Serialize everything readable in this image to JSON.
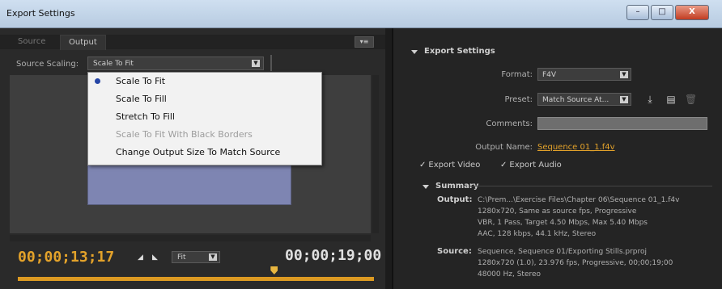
{
  "window": {
    "title": "Export Settings",
    "controls": {
      "minimize": "–",
      "maximize": "□",
      "close": "X"
    }
  },
  "left": {
    "tabs": [
      {
        "label": "Source"
      },
      {
        "label": "Output"
      }
    ],
    "panel_menu": "▾≡",
    "source_scaling": {
      "label": "Source Scaling:",
      "value": "Scale To Fit",
      "options": [
        {
          "label": "Scale To Fit",
          "selected": true,
          "enabled": true
        },
        {
          "label": "Scale To Fill",
          "selected": false,
          "enabled": true
        },
        {
          "label": "Stretch To Fill",
          "selected": false,
          "enabled": true
        },
        {
          "label": "Scale To Fit With Black Borders",
          "selected": false,
          "enabled": false
        },
        {
          "label": "Change Output Size To Match Source",
          "selected": false,
          "enabled": true
        }
      ]
    },
    "timecode_current": "00;00;13;17",
    "timecode_duration": "00;00;19;00",
    "zoom": "Fit",
    "playhead_fraction": 0.72
  },
  "right": {
    "export_settings": {
      "heading": "Export Settings",
      "format": {
        "label": "Format:",
        "value": "F4V"
      },
      "preset": {
        "label": "Preset:",
        "value": "Match Source At..."
      },
      "comments": {
        "label": "Comments:",
        "value": ""
      },
      "output_name": {
        "label": "Output Name:",
        "value": "Sequence 01_1.f4v"
      },
      "export_video": {
        "label": "Export Video",
        "checked": true
      },
      "export_audio": {
        "label": "Export Audio",
        "checked": true
      }
    },
    "summary": {
      "heading": "Summary",
      "output_label": "Output:",
      "output_lines": [
        "C:\\Prem...\\Exercise Files\\Chapter 06\\Sequence 01_1.f4v",
        "1280x720, Same as source fps, Progressive",
        "VBR, 1 Pass, Target 4.50 Mbps, Max 5.40 Mbps",
        "AAC, 128 kbps, 44.1 kHz, Stereo"
      ],
      "source_label": "Source:",
      "source_lines": [
        "Sequence, Sequence 01/Exporting Stills.prproj",
        "1280x720 (1.0), 23.976 fps, Progressive, 00;00;19;00",
        "48000 Hz, Stereo"
      ]
    }
  }
}
